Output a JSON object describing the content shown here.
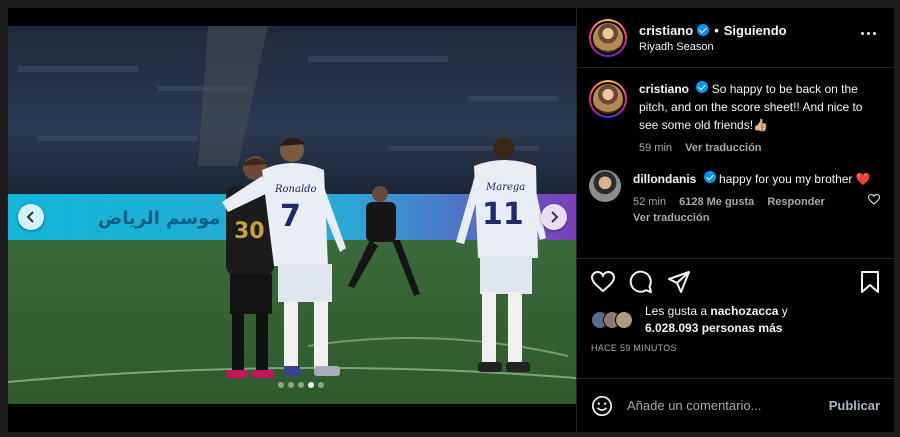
{
  "header": {
    "username": "cristiano",
    "separator": "•",
    "follow_state": "Siguiendo",
    "location": "Riyadh Season"
  },
  "caption": {
    "username": "cristiano",
    "text": "So happy to be back on the pitch, and on the score sheet!! And nice to see some old friends!👍🏼",
    "time": "59 min",
    "translate": "Ver traducción"
  },
  "comment": {
    "username": "dillondanis",
    "text": "happy for you my brother",
    "emoji": "❤️",
    "time": "52 min",
    "likes": "6128 Me gusta",
    "reply": "Responder",
    "translate": "Ver traducción"
  },
  "photo": {
    "banner_text": "موسم الرياض",
    "jersey_left_name": "Ronaldo",
    "jersey_left_number": "7",
    "jersey_right_name": "Marega",
    "jersey_right_number": "11",
    "dark_jersey_number": "30"
  },
  "carousel": {
    "total": 5,
    "active_index": 3
  },
  "likes": {
    "prefix": "Les gusta a",
    "user": "nachozacca",
    "connector": "y",
    "others": "6.028.093 personas más"
  },
  "posted_ago": "HACE 59 MINUTOS",
  "add_comment": {
    "placeholder": "Añade un comentario...",
    "publish": "Publicar"
  },
  "icons": [
    "chevron-left-icon",
    "chevron-right-icon",
    "more-icon",
    "heart-icon",
    "comment-icon",
    "share-icon",
    "bookmark-icon",
    "emoji-icon",
    "verified-icon"
  ],
  "colors": {
    "background": "#000000",
    "verified": "#0095f6",
    "heart": "#ff3040",
    "muted": "#a8a8a8"
  }
}
